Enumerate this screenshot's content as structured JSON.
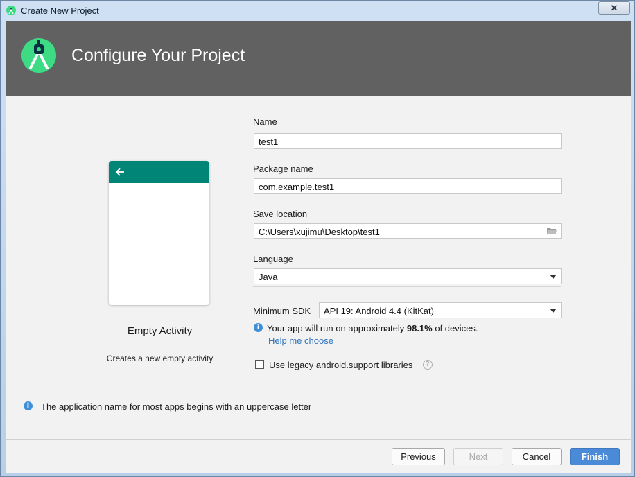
{
  "window": {
    "title": "Create New Project",
    "close_glyph": "✕"
  },
  "banner": {
    "title": "Configure Your Project",
    "logo_icon": "android-studio-logo"
  },
  "template": {
    "name": "Empty Activity",
    "description": "Creates a new empty activity",
    "appbar_color": "#008577"
  },
  "form": {
    "name_label": "Name",
    "name_value": "test1",
    "package_label": "Package name",
    "package_value": "com.example.test1",
    "save_label": "Save location",
    "save_value": "C:\\Users\\xujimu\\Desktop\\test1",
    "language_label": "Language",
    "language_value": "Java",
    "min_sdk_label": "Minimum SDK",
    "min_sdk_value": "API 19: Android 4.4 (KitKat)",
    "device_info_prefix": "Your app will run on approximately ",
    "device_info_percent": "98.1%",
    "device_info_suffix": " of devices.",
    "help_link": "Help me choose",
    "legacy_label": "Use legacy android.support libraries",
    "legacy_checked": false
  },
  "hint": {
    "text": "The application name for most apps begins with an uppercase letter"
  },
  "buttons": {
    "previous": "Previous",
    "next": "Next",
    "cancel": "Cancel",
    "finish": "Finish"
  },
  "colors": {
    "banner": "#616161",
    "accent": "#4a8ad6",
    "link": "#2f74c0"
  }
}
